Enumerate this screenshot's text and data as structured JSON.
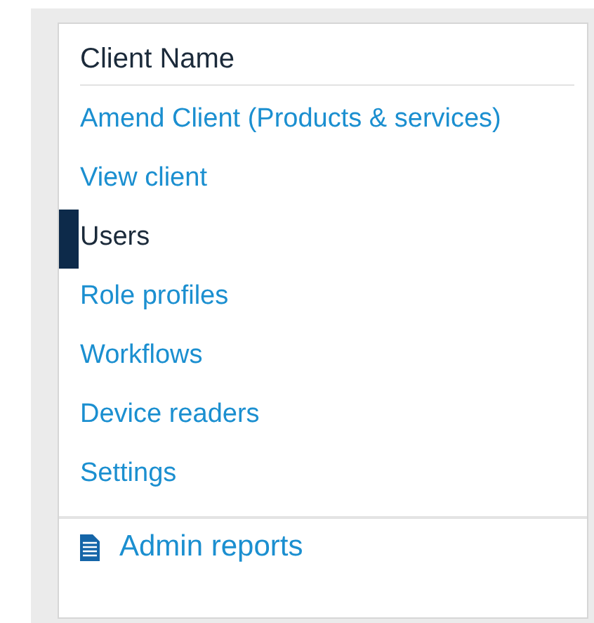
{
  "panel": {
    "title": "Client Name",
    "items": [
      {
        "label": "Amend Client (Products & services)",
        "selected": false
      },
      {
        "label": "View client",
        "selected": false
      },
      {
        "label": "Users",
        "selected": true
      },
      {
        "label": "Role profiles",
        "selected": false
      },
      {
        "label": "Workflows",
        "selected": false
      },
      {
        "label": "Device readers",
        "selected": false
      },
      {
        "label": "Settings",
        "selected": false
      }
    ],
    "footer_link": {
      "label": "Admin reports"
    }
  }
}
